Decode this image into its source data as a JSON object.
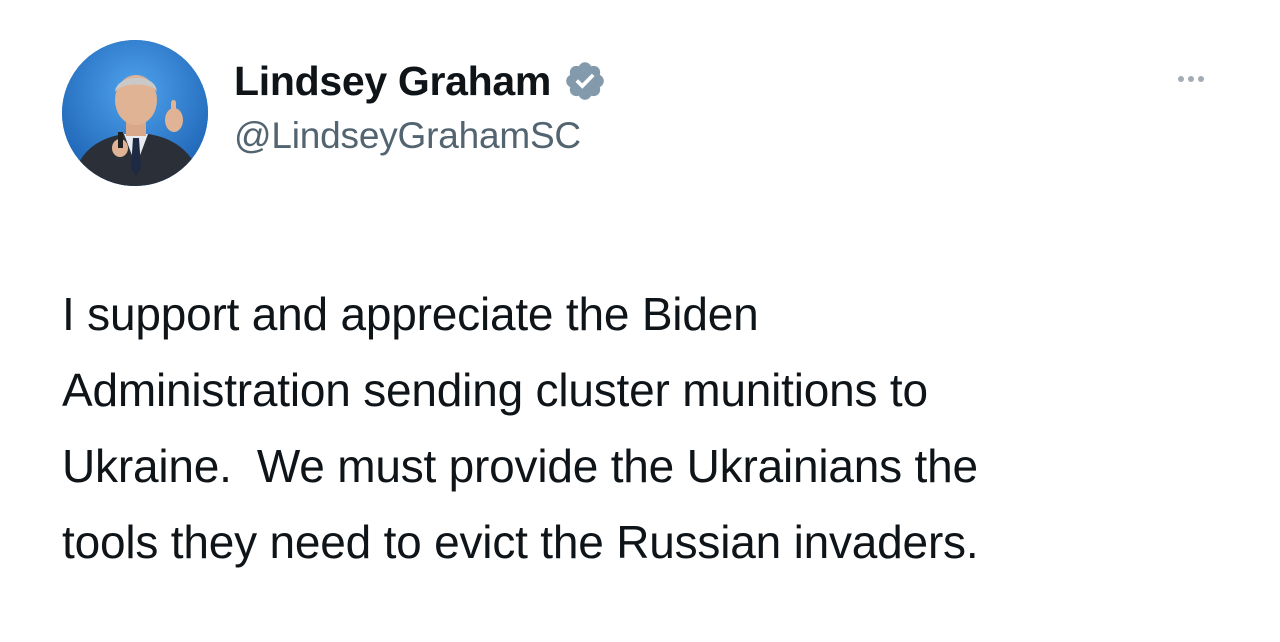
{
  "tweet": {
    "author": {
      "display_name": "Lindsey Graham",
      "handle": "@LindseyGrahamSC",
      "verified": true,
      "avatar_icon": "profile-photo",
      "verified_icon": "verified-badge-icon"
    },
    "more_icon": "more-options-icon",
    "text_lines": [
      "I support and appreciate the Biden",
      "Administration sending cluster munitions to",
      "Ukraine.  We must provide the Ukrainians the",
      "tools they need to evict the Russian invaders."
    ]
  },
  "colors": {
    "text_primary": "#0f1419",
    "text_secondary": "#536471",
    "verified_badge": "#829aab",
    "avatar_background": "#1a73c9",
    "more_dots": "#a3acb5",
    "background": "#ffffff"
  }
}
